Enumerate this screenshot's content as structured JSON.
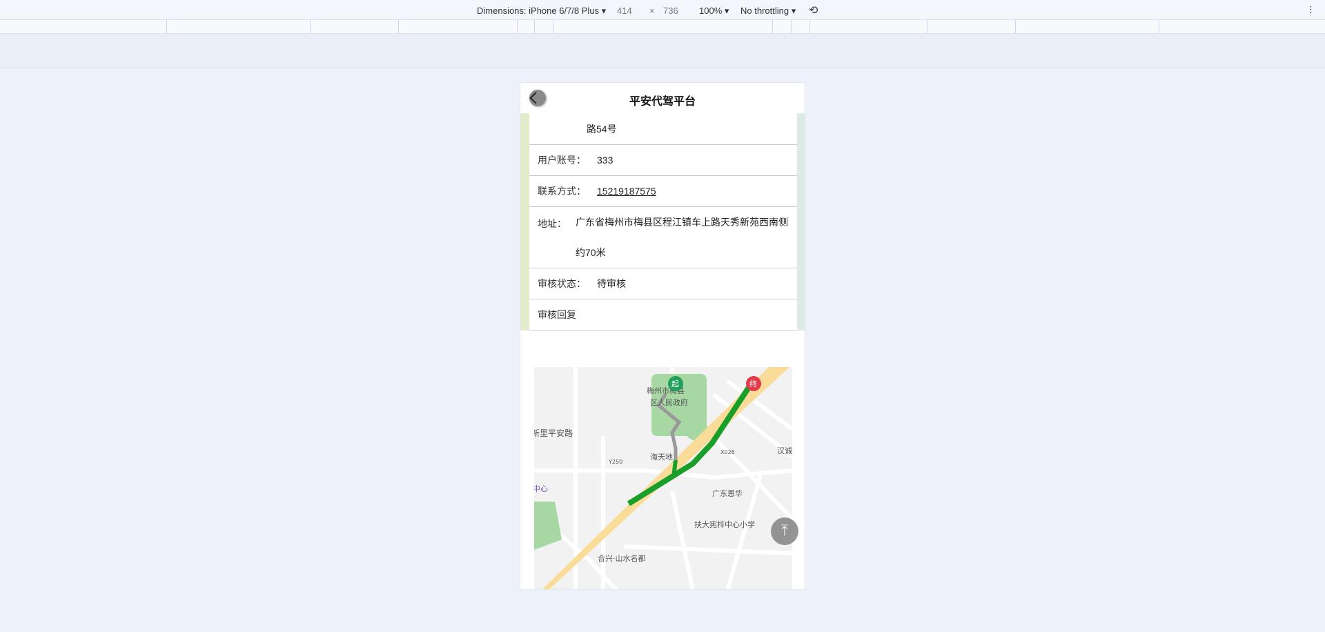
{
  "devtools": {
    "dimensions_label": "Dimensions: iPhone 6/7/8 Plus ▾",
    "width": "414",
    "times": "×",
    "height": "736",
    "zoom": "100% ▾",
    "throttling": "No throttling ▾",
    "more": "⋮"
  },
  "header": {
    "title": "平安代驾平台"
  },
  "details": {
    "address_tail": "路54号",
    "account_label": "用户账号：",
    "account": "333",
    "contact_label": "联系方式：",
    "contact": "15219187575",
    "address_label": "地址：",
    "address": "广东省梅州市梅县区程江镇车上路天秀新苑西南侧约70米",
    "status_label": "审核状态：",
    "status": "待审核",
    "reply_label": "审核回复"
  },
  "map": {
    "start_marker": "起",
    "end_marker": "终",
    "labels": [
      "梅州市梅县",
      "区人民政府",
      "新里平安路",
      "海天地",
      "广东恩华",
      "扶大宪梓中心小学",
      "合兴·山水名都",
      "汉诚",
      "中心",
      "X026",
      "Y250"
    ],
    "route_color": "#1a9e2a"
  }
}
